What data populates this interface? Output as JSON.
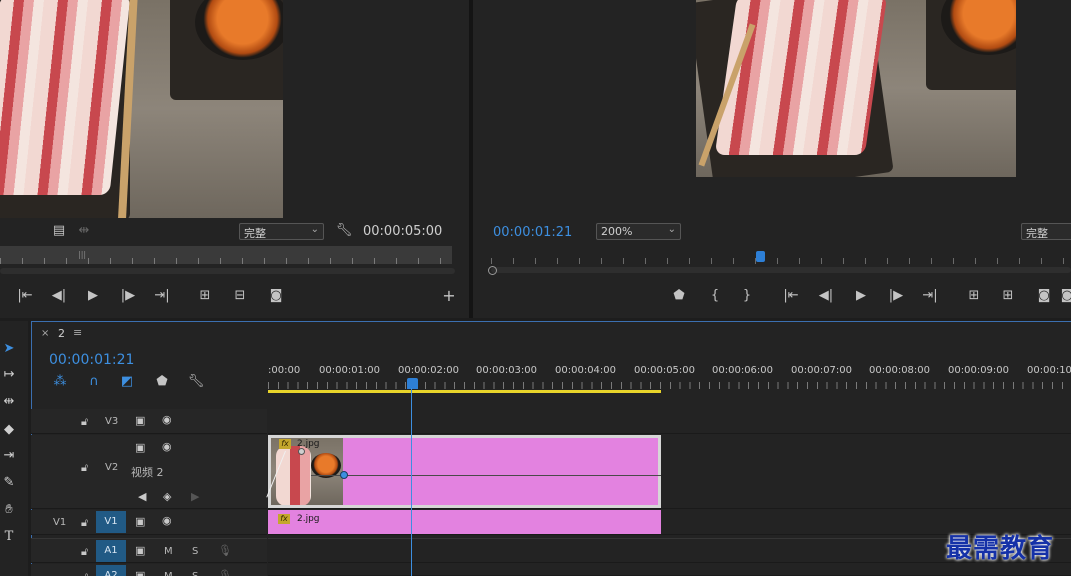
{
  "source_monitor": {
    "quality": "完整",
    "duration": "00:00:05:00"
  },
  "program_monitor": {
    "timecode": "00:00:01:21",
    "zoom": "200%",
    "quality": "完整"
  },
  "timeline": {
    "sequence_name": "2",
    "playhead_timecode": "00:00:01:21",
    "ruler_labels": [
      ":00:00",
      "00:00:01:00",
      "00:00:02:00",
      "00:00:03:00",
      "00:00:04:00",
      "00:00:05:00",
      "00:00:06:00",
      "00:00:07:00",
      "00:00:08:00",
      "00:00:09:00",
      "00:00:10:"
    ],
    "tracks": {
      "v3": "V3",
      "v2": "V2",
      "v2_name": "视频 2",
      "v1_source": "V1",
      "v1": "V1",
      "a1": "A1",
      "a2": "A2",
      "mute": "M",
      "solo": "S"
    },
    "clips": {
      "v2_clip": "2.jpg",
      "v1_clip": "2.jpg",
      "fx_badge": "fx"
    }
  },
  "watermark": "最需教育",
  "colors": {
    "accent_blue": "#3d8fe0",
    "clip_pink": "#e382e0",
    "track_target_blue": "#215a85",
    "work_area_yellow": "#e8d42a"
  }
}
